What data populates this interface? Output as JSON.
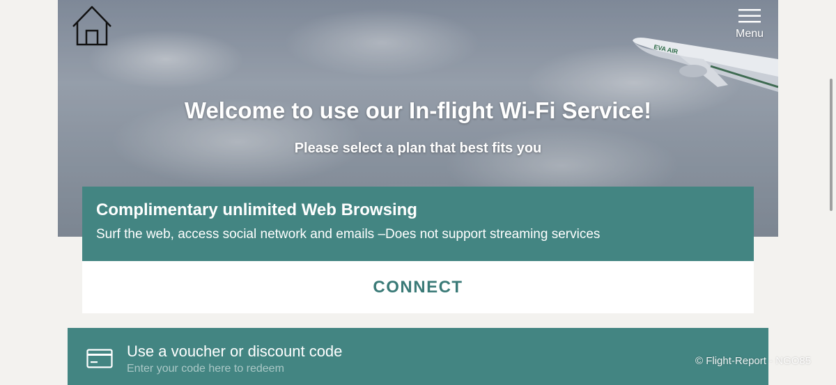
{
  "header": {
    "home_icon": "home-icon",
    "menu_icon": "hamburger-menu-icon",
    "menu_label": "Menu"
  },
  "hero": {
    "title": "Welcome to use our In-flight Wi-Fi Service!",
    "subtitle": "Please select a plan that best fits you",
    "airline_logo_text": "EVA AIR"
  },
  "plan": {
    "title": "Complimentary unlimited Web Browsing",
    "description": "Surf the web, access social network and emails –Does not support streaming services",
    "connect_label": "CONNECT"
  },
  "voucher": {
    "icon": "credit-card-icon",
    "title": "Use a voucher or discount code",
    "placeholder": "Enter your code here to redeem"
  },
  "watermark": "© Flight-Report - NGO85",
  "colors": {
    "teal": "#438582",
    "connect_text": "#3a7a77",
    "background": "#f3f2ef"
  }
}
